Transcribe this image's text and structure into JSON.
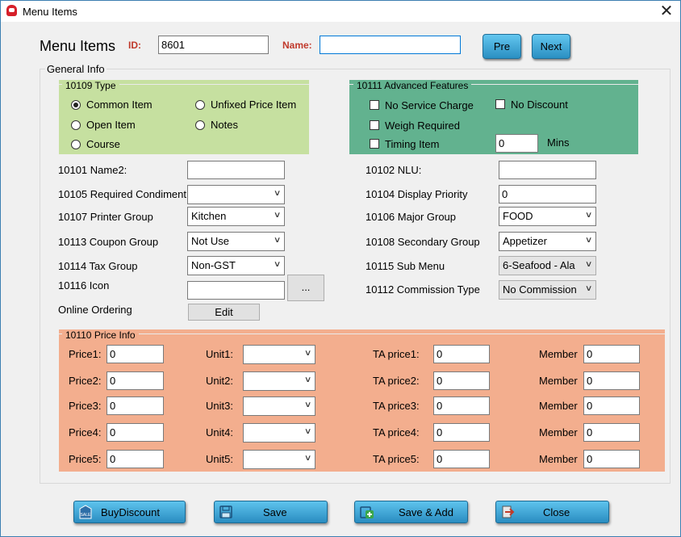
{
  "window": {
    "title": "Menu Items",
    "close_glyph": "✕"
  },
  "header": {
    "title": "Menu Items",
    "id_label": "ID:",
    "id_value": "8601",
    "name_label": "Name:",
    "name_value": "",
    "pre_label": "Pre",
    "next_label": "Next"
  },
  "general_info": {
    "title": "General Info"
  },
  "type_group": {
    "title": "10109 Type",
    "options": [
      "Common Item",
      "Unfixed Price Item",
      "Open Item",
      "Notes",
      "Course"
    ],
    "selected": "Common Item",
    "color": "#c6e0a0"
  },
  "advanced": {
    "title": "10111 Advanced Features",
    "no_service_charge": "No Service Charge",
    "no_discount": "No Discount",
    "weigh_required": "Weigh Required",
    "timing_item": "Timing Item",
    "mins_value": "0",
    "mins_label": "Mins",
    "color": "#62b28f"
  },
  "left_fields": {
    "name2_label": "10101 Name2:",
    "name2_value": "",
    "condiment_label": "10105 Required Condiment",
    "condiment_value": "",
    "printer_label": "10107 Printer Group",
    "printer_value": "Kitchen",
    "coupon_label": "10113 Coupon Group",
    "coupon_value": "Not Use",
    "tax_label": "10114 Tax Group",
    "tax_value": "Non-GST",
    "icon_label": "10116 Icon",
    "icon_value": "",
    "browse_label": "...",
    "online_label": "Online Ordering",
    "edit_label": "Edit"
  },
  "right_fields": {
    "nlu_label": "10102 NLU:",
    "nlu_value": "",
    "display_priority_label": "10104 Display Priority",
    "display_priority_value": "0",
    "major_label": "10106 Major Group",
    "major_value": "FOOD",
    "secondary_label": "10108 Secondary Group",
    "secondary_value": "Appetizer",
    "submenu_label": "10115 Sub Menu",
    "submenu_value": "6-Seafood - Ala",
    "commission_label": "10112 Commission Type",
    "commission_value": "No Commission"
  },
  "price_info": {
    "title": "10110 Price Info",
    "color": "#f3ae8e",
    "rows": [
      {
        "price_label": "Price1:",
        "price": "0",
        "unit_label": "Unit1:",
        "unit": "",
        "ta_label": "TA price1:",
        "ta": "0",
        "member_label": "Member",
        "member": "0"
      },
      {
        "price_label": "Price2:",
        "price": "0",
        "unit_label": "Unit2:",
        "unit": "",
        "ta_label": "TA price2:",
        "ta": "0",
        "member_label": "Member",
        "member": "0"
      },
      {
        "price_label": "Price3:",
        "price": "0",
        "unit_label": "Unit3:",
        "unit": "",
        "ta_label": "TA price3:",
        "ta": "0",
        "member_label": "Member",
        "member": "0"
      },
      {
        "price_label": "Price4:",
        "price": "0",
        "unit_label": "Unit4:",
        "unit": "",
        "ta_label": "TA price4:",
        "ta": "0",
        "member_label": "Member",
        "member": "0"
      },
      {
        "price_label": "Price5:",
        "price": "0",
        "unit_label": "Unit5:",
        "unit": "",
        "ta_label": "TA price5:",
        "ta": "0",
        "member_label": "Member",
        "member": "0"
      }
    ]
  },
  "footer": {
    "buy_discount": "BuyDiscount",
    "save": "Save",
    "save_add": "Save & Add",
    "close": "Close",
    "sale_icon_text": "SALE"
  },
  "colors": {
    "accent_button": "#3fa9d8",
    "label_red": "#c0392b",
    "focus_border": "#0078d7"
  }
}
